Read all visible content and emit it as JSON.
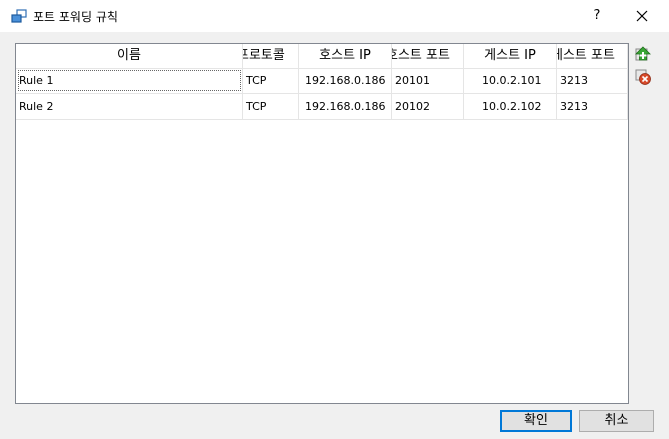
{
  "window": {
    "title": "포트 포워딩 규칙",
    "help_label": "?"
  },
  "table": {
    "columns": [
      "이름",
      "프로토콜",
      "호스트 IP",
      "호스트 포트",
      "게스트 IP",
      "게스트 포트"
    ],
    "rows": [
      [
        "Rule 1",
        "TCP",
        "192.168.0.186",
        "20101",
        "10.0.2.101",
        "3213"
      ],
      [
        "Rule 2",
        "TCP",
        "192.168.0.186",
        "20102",
        "10.0.2.102",
        "3213"
      ]
    ]
  },
  "side_buttons": {
    "add_icon": "add-rule-icon",
    "remove_icon": "remove-rule-icon"
  },
  "footer": {
    "ok_label": "확인",
    "cancel_label": "취소"
  },
  "colors": {
    "accent": "#0078d7",
    "add": "#3aa635",
    "remove": "#d84a2a"
  }
}
